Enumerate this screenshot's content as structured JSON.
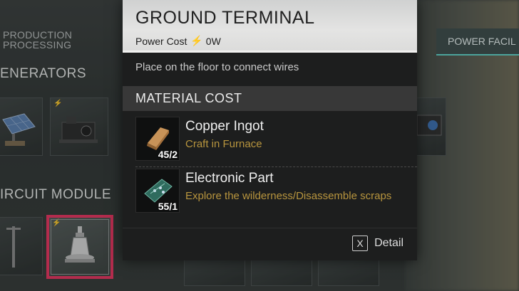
{
  "background": {
    "top_tab": "PRODUCTION\nPROCESSING",
    "top_tab_line1": "PRODUCTION",
    "top_tab_line2": "PROCESSING",
    "power_tab": "POWER FACIL",
    "section_generators": "ENERATORS",
    "section_circuit": "IRCUIT MODULE",
    "selection_color": "#e8335f",
    "accent_color": "#5fd3c8"
  },
  "popup": {
    "title": "GROUND TERMINAL",
    "power_cost_label": "Power Cost",
    "power_cost_value": "0W",
    "description": "Place on the floor to connect wires",
    "material_header": "MATERIAL COST",
    "materials": [
      {
        "name": "Copper Ingot",
        "source": "Craft in Furnace",
        "count": "45/2",
        "icon": "copper-ingot-icon"
      },
      {
        "name": "Electronic Part",
        "source": "Explore the wilderness/Disassemble scraps",
        "count": "55/1",
        "icon": "electronic-part-icon"
      }
    ],
    "detail_key": "X",
    "detail_label": "Detail",
    "source_color": "#b8953e"
  }
}
